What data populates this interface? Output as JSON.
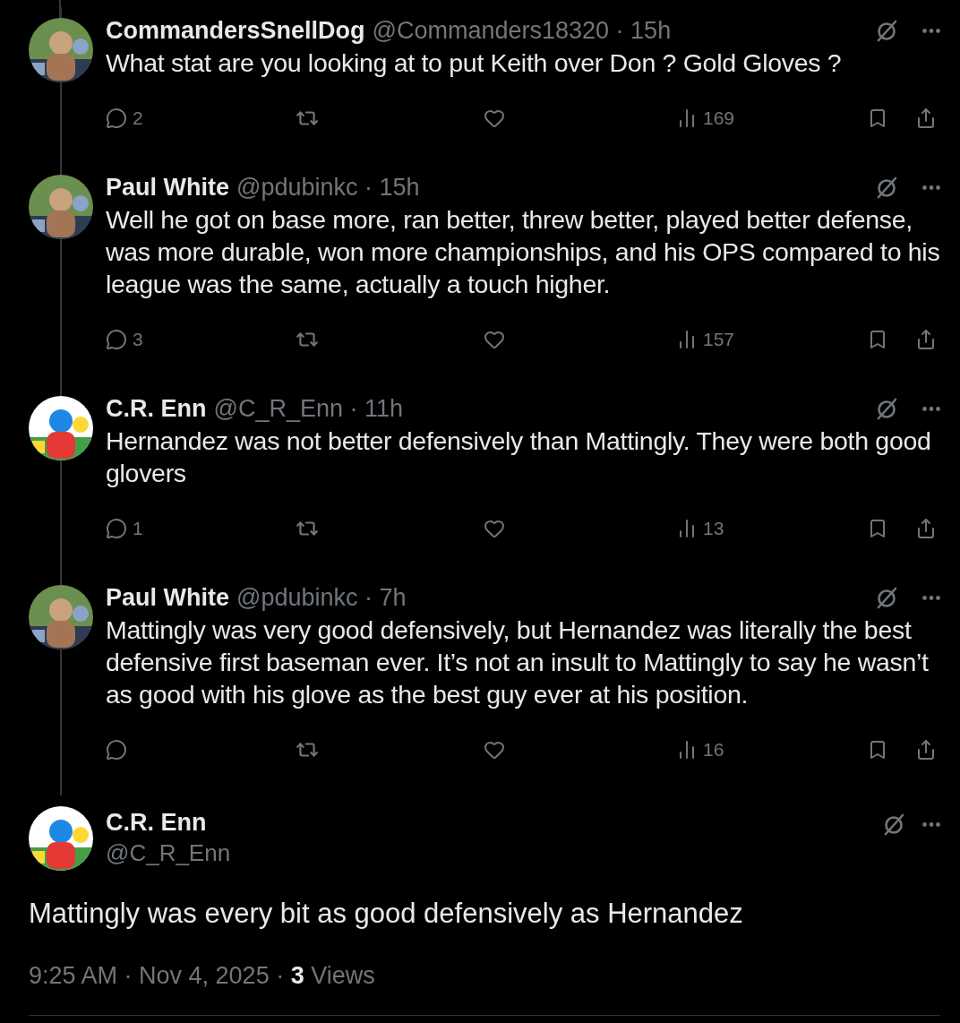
{
  "replies": [
    {
      "name": "CommandersSnellDog",
      "meta": "@Commanders18320 · 15h",
      "text": "What stat are you looking at to put Keith over Don ?   Gold Gloves ?",
      "replies": "2",
      "views": "169"
    },
    {
      "name": "Paul White",
      "meta": "@pdubinkc · 15h",
      "text": "Well he got on base more, ran better, threw better, played better defense, was more durable, won more championships, and his OPS compared to his league was the same, actually a touch higher.",
      "replies": "3",
      "views": "157"
    },
    {
      "name": "C.R. Enn",
      "meta": "@C_R_Enn · 11h",
      "text": "Hernandez was not better defensively than Mattingly. They were both good glovers",
      "replies": "1",
      "views": "13"
    },
    {
      "name": "Paul White",
      "meta": "@pdubinkc · 7h",
      "text": "Mattingly was very good defensively, but Hernandez was literally the best defensive first baseman ever. It’s not an insult to Mattingly to say he wasn’t as good with his glove as the best guy ever at his position.",
      "views": "16"
    }
  ],
  "main_tweet": {
    "name": "C.R. Enn",
    "handle": "@C_R_Enn",
    "text": "Mattingly was every bit as good defensively as Hernandez",
    "footer": "9:25 AM · Nov 4, 2025 · **3** Views"
  }
}
